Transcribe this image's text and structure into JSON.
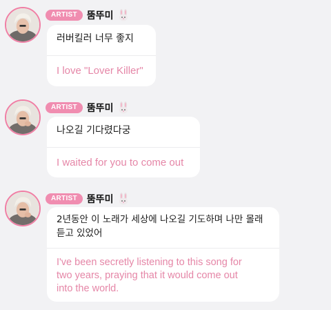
{
  "messages": [
    {
      "badge": "ARTIST",
      "nickname": "뚬뚜미",
      "original": "러버킬러 너무 좋지",
      "translation": "I love \"Lover Killer\""
    },
    {
      "badge": "ARTIST",
      "nickname": "뚬뚜미",
      "original": "나오길 기다렸다궁",
      "translation": "I waited for you to come out"
    },
    {
      "badge": "ARTIST",
      "nickname": "뚬뚜미",
      "original_line1": "2년동안 이 노래가 세상에 나오길 기도하며 나만 몰래",
      "original_line2": "듣고 있었어",
      "translation_line1": "I've been secretly listening to this song for",
      "translation_line2": "two years, praying that it would come out",
      "translation_line3": "into the world."
    }
  ],
  "colors": {
    "accent": "#f08db0",
    "translation_text": "#e586a7",
    "background": "#f2f2f4"
  },
  "icons": {
    "avatar": "artist-avatar",
    "emoji": "rabbit-face-icon"
  }
}
